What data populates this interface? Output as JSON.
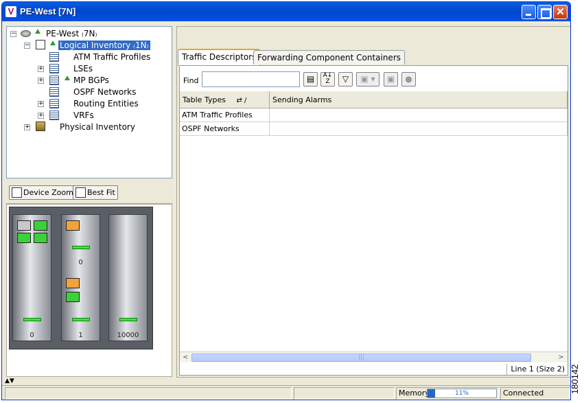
{
  "window": {
    "title": "PE-West [7N]",
    "app_icon": "V",
    "close_glyph": "✕"
  },
  "tree": {
    "root": "PE-West ₍7N₎",
    "logical": "Logical Inventory ₍1N₎",
    "items": [
      "ATM Traffic Profiles",
      "LSEs",
      "MP BGPs",
      "OSPF Networks",
      "Routing Entities",
      "VRFs"
    ],
    "physical": "Physical Inventory"
  },
  "zoom_toolbar": {
    "device_zoom": "Device Zoom",
    "best_fit": "Best Fit"
  },
  "device": {
    "slots": [
      "0",
      "1",
      "10000"
    ],
    "sub_slot": "0"
  },
  "tabs": {
    "traffic": "Traffic Descriptors",
    "forwarding": "Forwarding Component Containers"
  },
  "find": {
    "label": "Find :",
    "value": ""
  },
  "table": {
    "headers": [
      "Table Types",
      "Sending Alarms"
    ],
    "sort_glyph": "⇄ /",
    "rows": [
      [
        "ATM Traffic Profiles",
        ""
      ],
      [
        "OSPF Networks",
        ""
      ]
    ]
  },
  "scroll": {
    "left": "<",
    "right": ">",
    "grip": "|||"
  },
  "line_status": "Line 1 (Size 2)",
  "status": {
    "memory_label": "Memory:",
    "memory_percent": 11,
    "memory_text": "11%",
    "connection": "Connected"
  },
  "figure_id": "180142",
  "colors": {
    "titlebar": "#0047cf",
    "selection": "#316ac5",
    "led": "#38e838",
    "memory": "#2b63c8"
  }
}
